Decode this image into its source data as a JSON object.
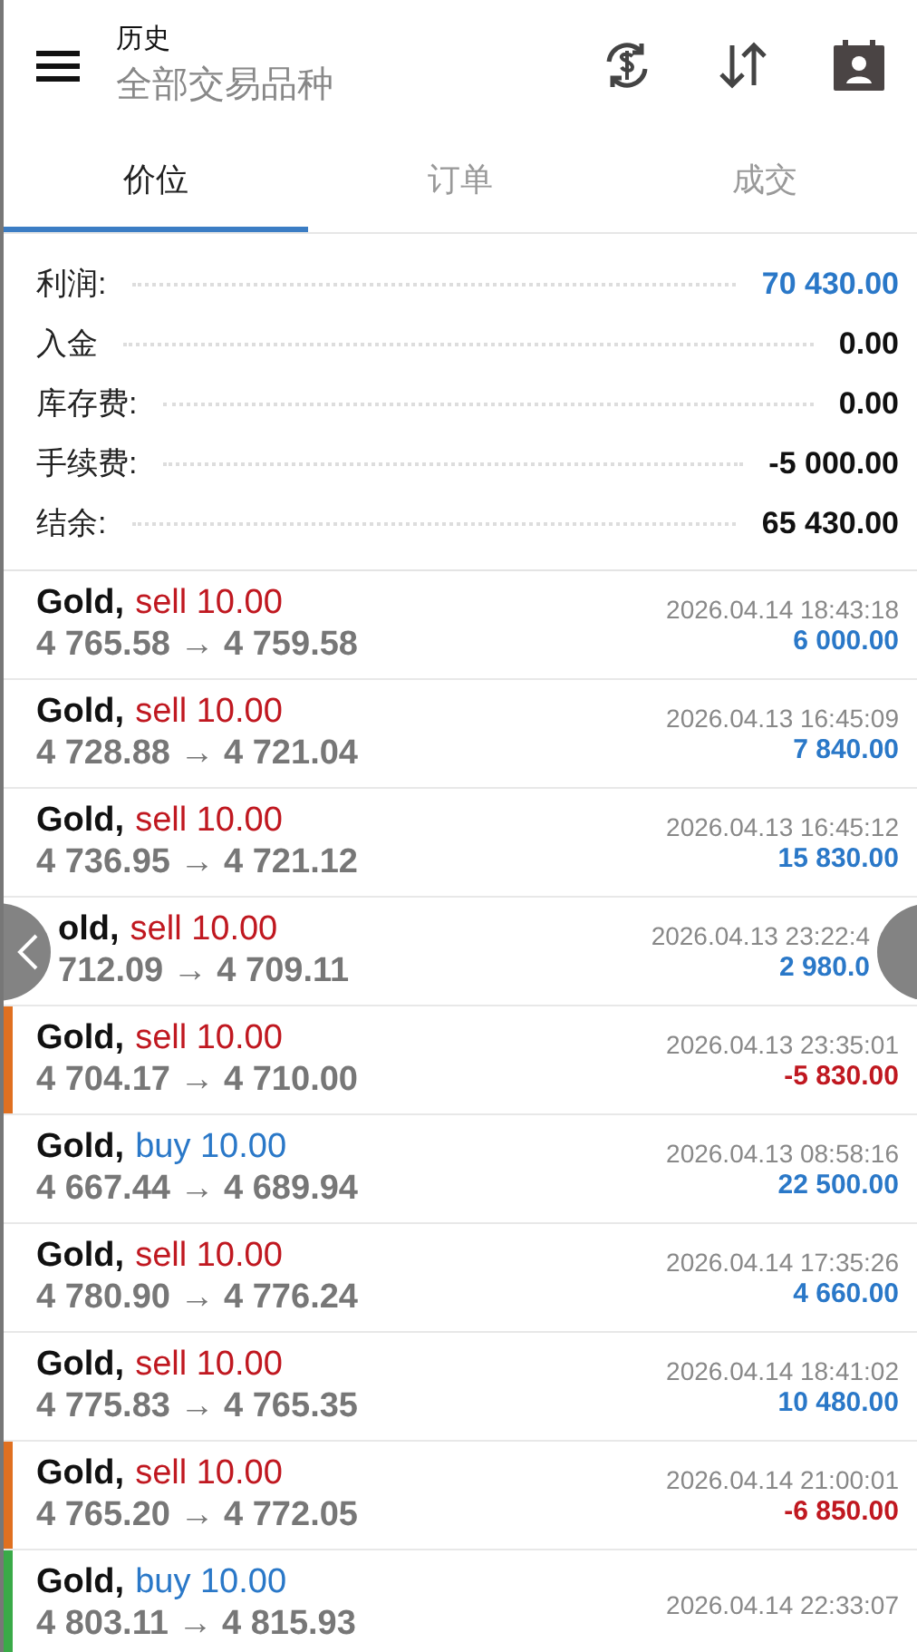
{
  "header": {
    "title": "历史",
    "subtitle": "全部交易品种"
  },
  "tabs": [
    {
      "label": "价位",
      "selected": true
    },
    {
      "label": "订单",
      "selected": false
    },
    {
      "label": "成交",
      "selected": false
    }
  ],
  "summary": [
    {
      "label": "利润:",
      "value": "70 430.00",
      "highlight": true
    },
    {
      "label": "入金",
      "value": "0.00",
      "highlight": false
    },
    {
      "label": "库存费:",
      "value": "0.00",
      "highlight": false
    },
    {
      "label": "手续费:",
      "value": "-5 000.00",
      "highlight": false
    },
    {
      "label": "结余:",
      "value": "65 430.00",
      "highlight": false
    }
  ],
  "deals": [
    {
      "symbol": "Gold,",
      "side": "sell 10.00",
      "kind": "sell",
      "prices": "4 765.58 → 4 759.58",
      "time": "2026.04.14 18:43:18",
      "profit": "6 000.00",
      "loss": false
    },
    {
      "symbol": "Gold,",
      "side": "sell 10.00",
      "kind": "sell",
      "prices": "4 728.88 → 4 721.04",
      "time": "2026.04.13 16:45:09",
      "profit": "7 840.00",
      "loss": false
    },
    {
      "symbol": "Gold,",
      "side": "sell 10.00",
      "kind": "sell",
      "prices": "4 736.95 → 4 721.12",
      "time": "2026.04.13 16:45:12",
      "profit": "15 830.00",
      "loss": false
    },
    {
      "symbol": "old,",
      "side": "sell 10.00",
      "kind": "sell",
      "prices": "712.09 → 4 709.11",
      "time": "2026.04.13 23:22:4",
      "profit": "2 980.0",
      "loss": false,
      "covered": true
    },
    {
      "symbol": "Gold,",
      "side": "sell 10.00",
      "kind": "sell",
      "prices": "4 704.17 → 4 710.00",
      "time": "2026.04.13 23:35:01",
      "profit": "-5 830.00",
      "loss": true,
      "color": "#e07020"
    },
    {
      "symbol": "Gold,",
      "side": "buy 10.00",
      "kind": "buy",
      "prices": "4 667.44 → 4 689.94",
      "time": "2026.04.13 08:58:16",
      "profit": "22 500.00",
      "loss": false
    },
    {
      "symbol": "Gold,",
      "side": "sell 10.00",
      "kind": "sell",
      "prices": "4 780.90 → 4 776.24",
      "time": "2026.04.14 17:35:26",
      "profit": "4 660.00",
      "loss": false
    },
    {
      "symbol": "Gold,",
      "side": "sell 10.00",
      "kind": "sell",
      "prices": "4 775.83 → 4 765.35",
      "time": "2026.04.14 18:41:02",
      "profit": "10 480.00",
      "loss": false
    },
    {
      "symbol": "Gold,",
      "side": "sell 10.00",
      "kind": "sell",
      "prices": "4 765.20 → 4 772.05",
      "time": "2026.04.14 21:00:01",
      "profit": "-6 850.00",
      "loss": true,
      "color": "#e07020"
    },
    {
      "symbol": "Gold,",
      "side": "buy 10.00",
      "kind": "buy",
      "prices": "4 803.11 → 4 815.93",
      "time": "2026.04.14 22:33:07",
      "color": "#3aaa48"
    }
  ]
}
